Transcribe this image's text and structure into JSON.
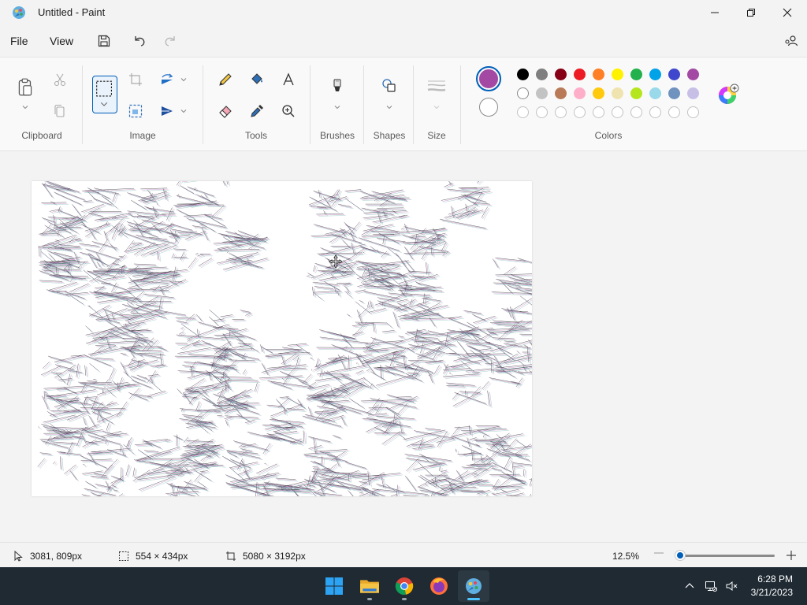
{
  "window": {
    "title": "Untitled - Paint"
  },
  "menu": {
    "file": "File",
    "view": "View"
  },
  "ribbon": {
    "groups": {
      "clipboard": "Clipboard",
      "image": "Image",
      "tools": "Tools",
      "brushes": "Brushes",
      "shapes": "Shapes",
      "size": "Size",
      "colors": "Colors"
    },
    "primary_color": "#a349a4",
    "secondary_color": "#ffffff",
    "palette_row1": [
      "#000000",
      "#7f7f7f",
      "#880015",
      "#ed1c24",
      "#ff7f27",
      "#fff200",
      "#22b14c",
      "#00a2e8",
      "#3f48cc",
      "#a349a4"
    ],
    "palette_row2": [
      "#ffffff",
      "#c3c3c3",
      "#b97a57",
      "#ffaec9",
      "#ffc90e",
      "#efe4b0",
      "#b5e61d",
      "#99d9ea",
      "#7092be",
      "#c8bfe7"
    ],
    "palette_row3_empty_count": 10
  },
  "status": {
    "cursor_position": "3081, 809px",
    "selection_size": "554 × 434px",
    "canvas_size": "5080 × 3192px",
    "zoom": "12.5%"
  },
  "taskbar": {
    "time": "6:28 PM",
    "date": "3/21/2023",
    "apps": [
      "windows-start",
      "file-explorer",
      "chrome",
      "firefox",
      "paint"
    ]
  }
}
